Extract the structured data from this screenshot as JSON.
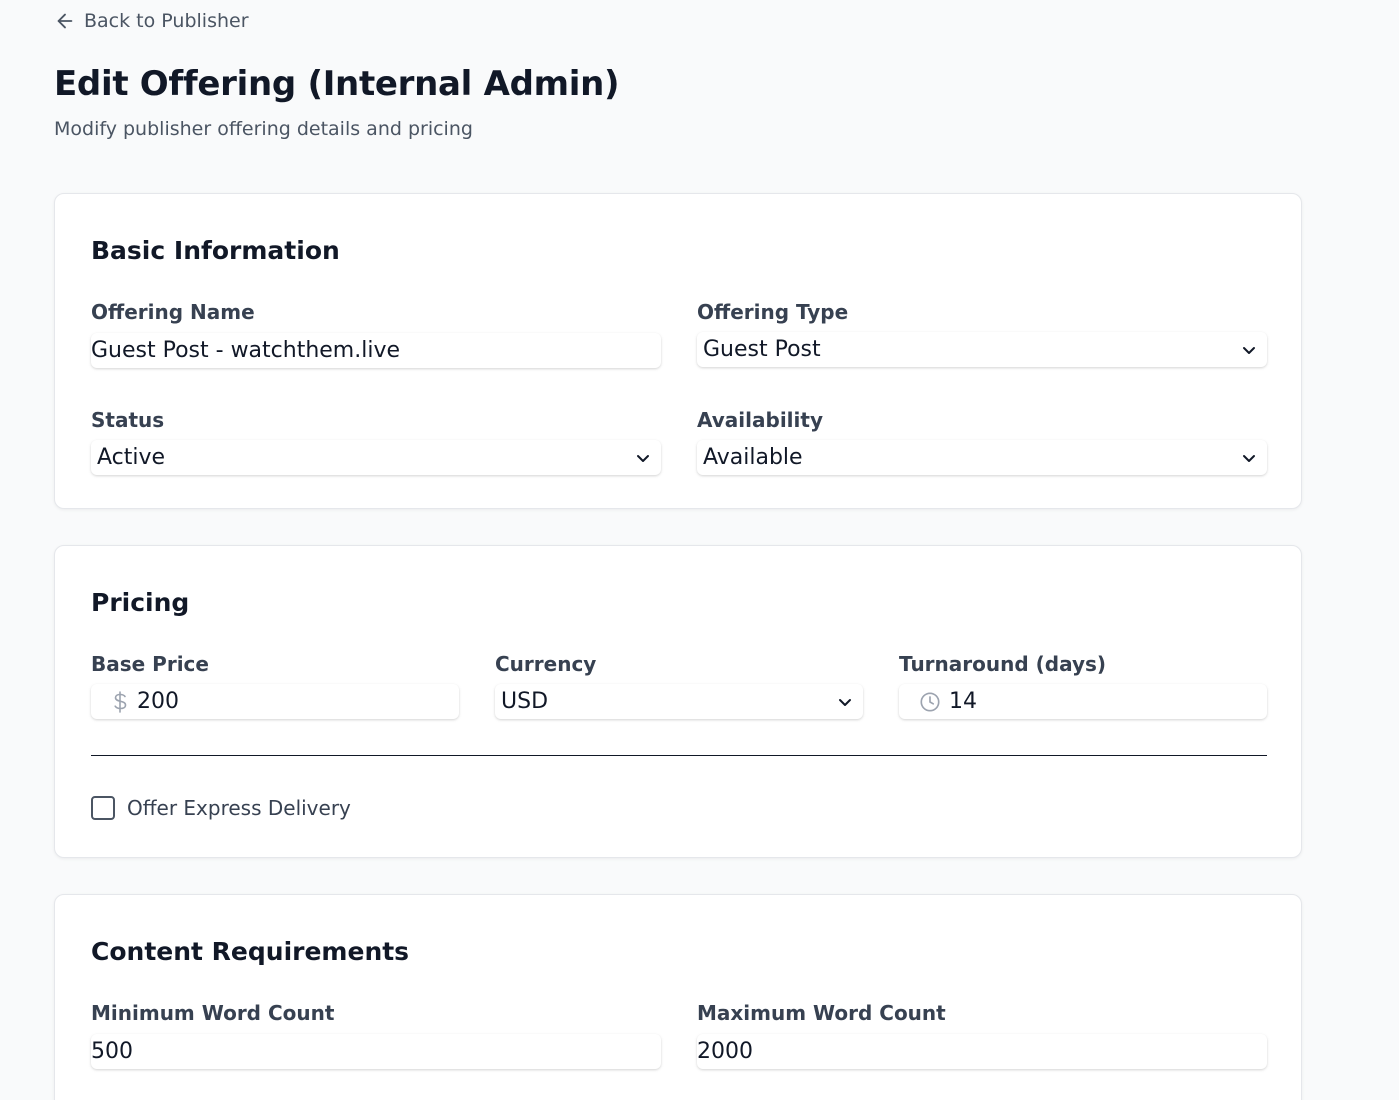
{
  "nav": {
    "back_label": "Back to Publisher"
  },
  "header": {
    "title": "Edit Offering (Internal Admin)",
    "subtitle": "Modify publisher offering details and pricing"
  },
  "basic_info": {
    "title": "Basic Information",
    "offering_name": {
      "label": "Offering Name",
      "value": "Guest Post - watchthem.live"
    },
    "offering_type": {
      "label": "Offering Type",
      "value": "Guest Post"
    },
    "status": {
      "label": "Status",
      "value": "Active"
    },
    "availability": {
      "label": "Availability",
      "value": "Available"
    }
  },
  "pricing": {
    "title": "Pricing",
    "base_price": {
      "label": "Base Price",
      "value": "200",
      "prefix_icon": "dollar-icon"
    },
    "currency": {
      "label": "Currency",
      "value": "USD"
    },
    "turnaround": {
      "label": "Turnaround (days)",
      "value": "14",
      "prefix_icon": "clock-icon"
    },
    "express_delivery": {
      "label": "Offer Express Delivery",
      "checked": false
    }
  },
  "content_requirements": {
    "title": "Content Requirements",
    "min_word_count": {
      "label": "Minimum Word Count",
      "value": "500"
    },
    "max_word_count": {
      "label": "Maximum Word Count",
      "value": "2000"
    }
  },
  "colors": {
    "background": "#f9fafb",
    "card": "#ffffff",
    "text_primary": "#111827",
    "text_secondary": "#4b5563",
    "icon_muted": "#9ca3af"
  }
}
